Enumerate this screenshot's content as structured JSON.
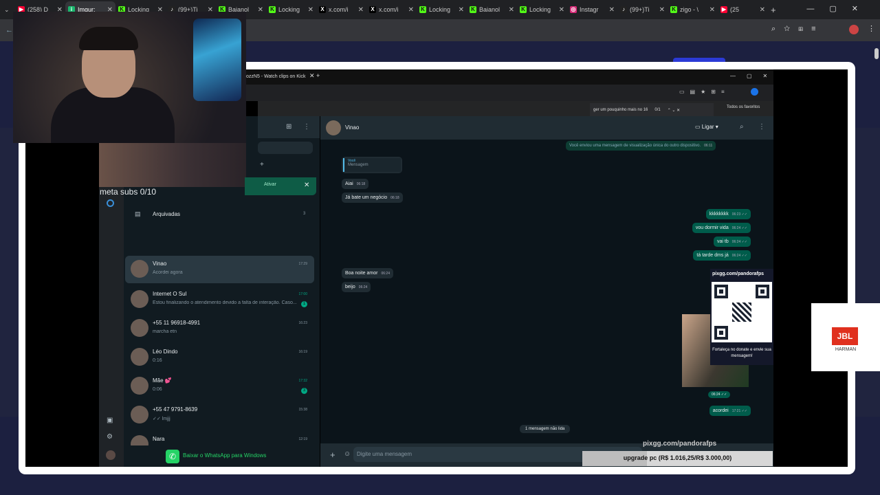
{
  "browser": {
    "tabs": [
      {
        "icon": "youtube-icon",
        "label": "(258) D",
        "active": false
      },
      {
        "icon": "imgur-icon",
        "label": "Imgur:",
        "active": true
      },
      {
        "icon": "kick-icon",
        "label": "Locking",
        "active": false
      },
      {
        "icon": "tiktok-icon",
        "label": "(99+)Ti",
        "active": false
      },
      {
        "icon": "kick-icon",
        "label": "Baianol",
        "active": false
      },
      {
        "icon": "kick-icon",
        "label": "Locking",
        "active": false
      },
      {
        "icon": "x-icon",
        "label": "x.com/i",
        "active": false
      },
      {
        "icon": "x-icon",
        "label": "x.com/i",
        "active": false
      },
      {
        "icon": "kick-icon",
        "label": "Locking",
        "active": false
      },
      {
        "icon": "kick-icon",
        "label": "Baianol",
        "active": false
      },
      {
        "icon": "kick-icon",
        "label": "Locking",
        "active": false
      },
      {
        "icon": "instagram-icon",
        "label": "Instagr",
        "active": false
      },
      {
        "icon": "tiktok-icon",
        "label": "(99+)Ti",
        "active": false
      },
      {
        "icon": "kick-icon",
        "label": "zigo - \\",
        "active": false
      },
      {
        "icon": "youtube-icon",
        "label": "(25",
        "active": false
      }
    ]
  },
  "inner_browser": {
    "tab_title": "ozzN5 - Watch clips on Kick",
    "find_text": "ger um pouquinho mais no 16",
    "find_count": "0/1",
    "bookmarks_label": "Todos os favoritos"
  },
  "overlay": {
    "goal_text": "meta subs 0/10",
    "notice_text": "Ativar",
    "qr_url": "pixgg.com/pandorafps",
    "qr_caption": "Fortaleça no donate e envie sua mensagem!",
    "pix_bottom": "pixgg.com/pandorafps",
    "upgrade_text": "upgrade pc (R$ 1.016,25/R$ 3.000,00)",
    "upgrade_progress": 0.339,
    "jbl_brand": "JBL",
    "jbl_sub": "HARMAN"
  },
  "whatsapp": {
    "archived_label": "Arquivadas",
    "archived_count": "3",
    "chats": [
      {
        "name": "Vinao",
        "preview": "Acordei agora",
        "time": "17:29",
        "unread": "",
        "selected": true
      },
      {
        "name": "Internet O Sul",
        "preview": "Estou finalizando o atendimento devido a falta de interação. Caso...",
        "time": "17:00",
        "unread": "1",
        "selected": false
      },
      {
        "name": "+55 11 96918-4991",
        "preview": "marcha etn",
        "time": "16:23",
        "unread": "",
        "selected": false
      },
      {
        "name": "Léo Dindo",
        "preview": "0:16",
        "time": "16:19",
        "unread": "",
        "selected": false
      },
      {
        "name": "Mãe 💕",
        "preview": "0:06",
        "time": "17:32",
        "unread": "3",
        "selected": false
      },
      {
        "name": "+55 47 9791-8639",
        "preview": "✓✓ lmjjj",
        "time": "15:38",
        "unread": "",
        "selected": false
      },
      {
        "name": "Nara",
        "preview": "",
        "time": "12:19",
        "unread": "",
        "selected": false
      }
    ],
    "download_banner": "Baixar o WhatsApp para Windows",
    "contact_name": "Vinao",
    "call_label": "Ligar",
    "system_message": "Você enviou uma mensagem de visualização única do outro dispositivo.",
    "system_time": "06:11",
    "quote_author": "Você",
    "quote_text": "Mensagem",
    "messages_in": [
      {
        "text": "Aiai",
        "time": "06:18"
      },
      {
        "text": "Já bate um negócio",
        "time": "06:18"
      },
      {
        "text": "Boa noite amor",
        "time": "06:24"
      },
      {
        "text": "beijo",
        "time": "06:24"
      }
    ],
    "messages_out": [
      {
        "text": "kkkkkkkk",
        "time": "06:23 ✓✓"
      },
      {
        "text": "vou dormir vida",
        "time": "06:24 ✓✓"
      },
      {
        "text": "vai tb",
        "time": "06:24 ✓✓"
      },
      {
        "text": "tá tarde dms já",
        "time": "06:24 ✓✓"
      },
      {
        "text": "acordei",
        "time": "17:21 ✓✓"
      }
    ],
    "image_time": "06:24 ✓✓",
    "unread_divider": "1 mensagem não lida",
    "input_placeholder": "Digite uma mensagem"
  },
  "colors": {
    "wa_green": "#00a884",
    "out_bubble": "#005c4b",
    "in_bubble": "#202c33"
  }
}
